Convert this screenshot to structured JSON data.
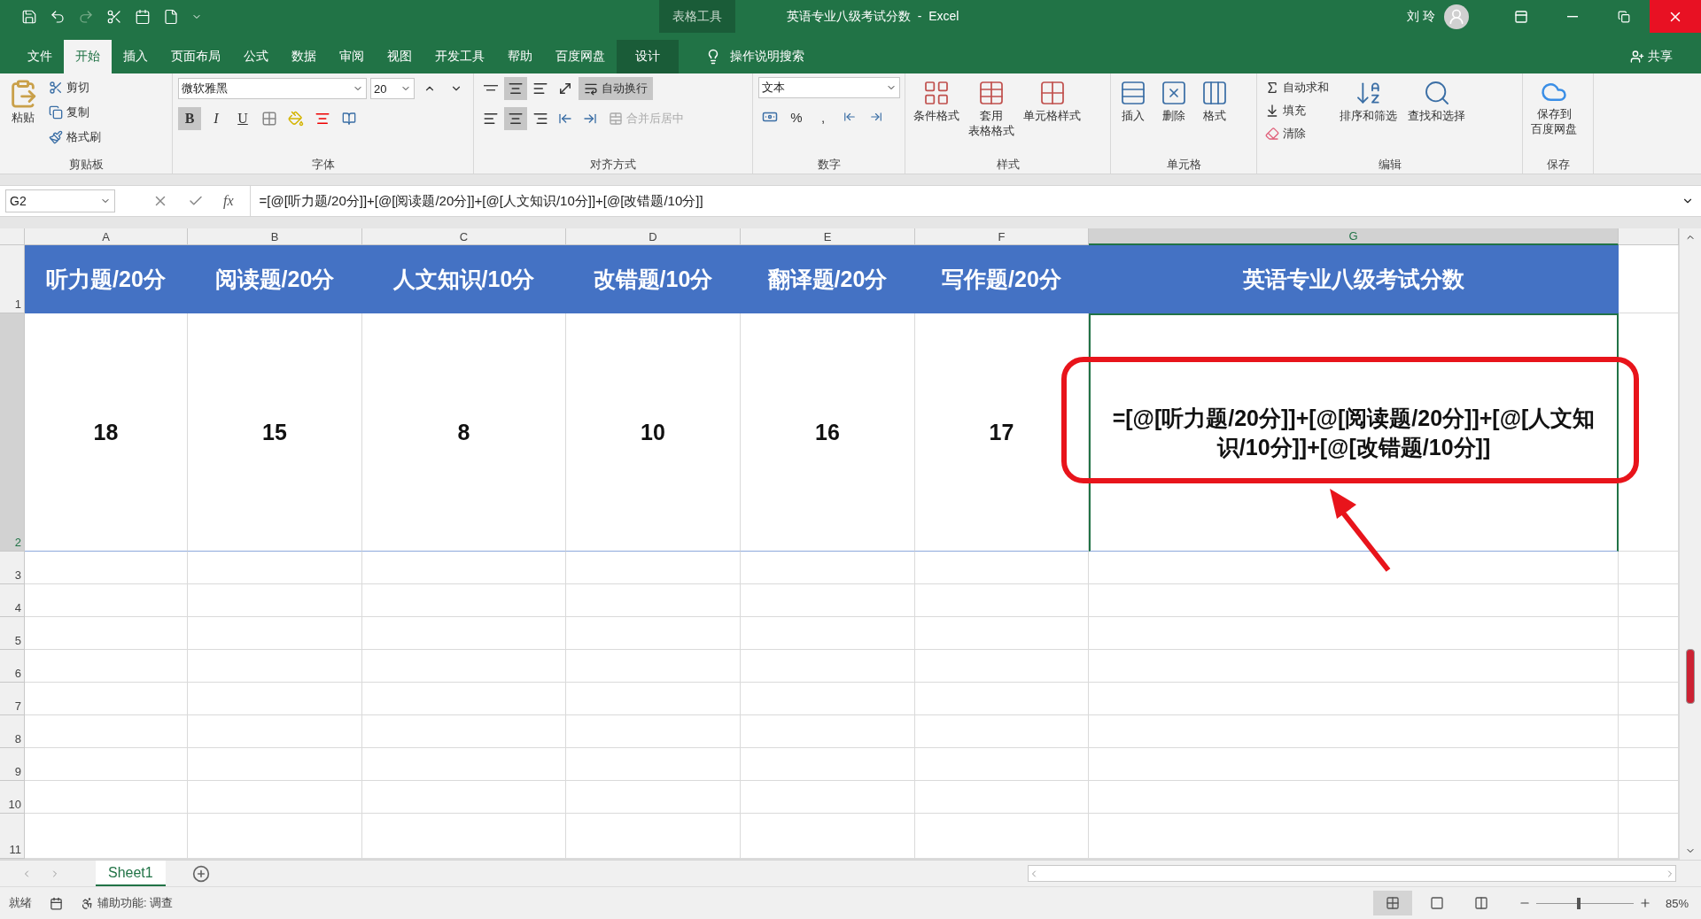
{
  "window": {
    "title": "英语专业八级考试分数  -  Excel",
    "context_label": "表格工具",
    "user": "刘 玲"
  },
  "tabs": [
    {
      "label": "文件",
      "selected": false
    },
    {
      "label": "开始",
      "selected": true
    },
    {
      "label": "插入",
      "selected": false
    },
    {
      "label": "页面布局",
      "selected": false
    },
    {
      "label": "公式",
      "selected": false
    },
    {
      "label": "数据",
      "selected": false
    },
    {
      "label": "审阅",
      "selected": false
    },
    {
      "label": "视图",
      "selected": false
    },
    {
      "label": "开发工具",
      "selected": false
    },
    {
      "label": "帮助",
      "selected": false
    },
    {
      "label": "百度网盘",
      "selected": false
    },
    {
      "label": "设计",
      "selected": false
    }
  ],
  "tell_me": {
    "placeholder": "操作说明搜索"
  },
  "share": "共享",
  "ribbon": {
    "clipboard": {
      "label": "剪贴板",
      "paste": "粘贴",
      "items": [
        "剪切",
        "复制",
        "格式刷"
      ]
    },
    "font": {
      "label": "字体",
      "font_name": "微软雅黑",
      "font_size": "20",
      "styles": [
        {
          "label": "B",
          "selected": true
        },
        {
          "label": "I",
          "selected": false
        },
        {
          "label": "U",
          "selected": false
        }
      ]
    },
    "alignment": {
      "label": "对齐方式",
      "wrap": {
        "label": "自动换行",
        "selected": true
      },
      "merge": {
        "label": "合并后居中",
        "disabled": true
      }
    },
    "number": {
      "label": "数字",
      "format": "文本",
      "percent": "%",
      "comma": ","
    },
    "styles": {
      "label": "样式",
      "items": [
        [
          "条件格式"
        ],
        [
          "套用",
          "表格格式"
        ],
        [
          "单元格样式"
        ]
      ]
    },
    "cells": {
      "label": "单元格",
      "items": [
        "插入",
        "删除",
        "格式"
      ]
    },
    "editing": {
      "label": "编辑",
      "small": [
        "自动求和",
        "填充",
        "清除"
      ],
      "large": [
        "排序和筛选",
        "查找和选择"
      ]
    },
    "save": {
      "label": "保存",
      "lines": [
        "保存到",
        "百度网盘"
      ]
    }
  },
  "formula_bar": {
    "name_box": "G2",
    "fx": "fx",
    "formula": "=[@[听力题/20分]]+[@[阅读题/20分]]+[@[人文知识/10分]]+[@[改错题/10分]]"
  },
  "columns": [
    {
      "label": "A",
      "selected": false
    },
    {
      "label": "B",
      "selected": false
    },
    {
      "label": "C",
      "selected": false
    },
    {
      "label": "D",
      "selected": false
    },
    {
      "label": "E",
      "selected": false
    },
    {
      "label": "F",
      "selected": false
    },
    {
      "label": "G",
      "selected": true
    }
  ],
  "rows": [
    {
      "label": "1",
      "selected": false,
      "cells": [
        "听力题/20分",
        "阅读题/20分",
        "人文知识/10分",
        "改错题/10分",
        "翻译题/20分",
        "写作题/20分",
        "英语专业八级考试分数"
      ]
    },
    {
      "label": "2",
      "selected": true,
      "cells": [
        "18",
        "15",
        "8",
        "10",
        "16",
        "17",
        "=[@[听力题/20分]]+[@[阅读题/20分]]+[@[人文知识/10分]]+[@[改错题/10分]]"
      ]
    },
    {
      "label": "3",
      "selected": false,
      "cells": []
    },
    {
      "label": "4",
      "selected": false,
      "cells": []
    },
    {
      "label": "5",
      "selected": false,
      "cells": []
    },
    {
      "label": "6",
      "selected": false,
      "cells": []
    },
    {
      "label": "7",
      "selected": false,
      "cells": []
    },
    {
      "label": "8",
      "selected": false,
      "cells": []
    },
    {
      "label": "9",
      "selected": false,
      "cells": []
    },
    {
      "label": "10",
      "selected": false,
      "cells": []
    },
    {
      "label": "11",
      "selected": false,
      "cells": []
    }
  ],
  "sheets": [
    {
      "label": "Sheet1",
      "selected": true
    }
  ],
  "status_bar": {
    "ready": "就绪",
    "accessibility": "辅助功能: 调查",
    "zoom": "85%",
    "zoom_level": {
      "level": 0.42
    }
  }
}
